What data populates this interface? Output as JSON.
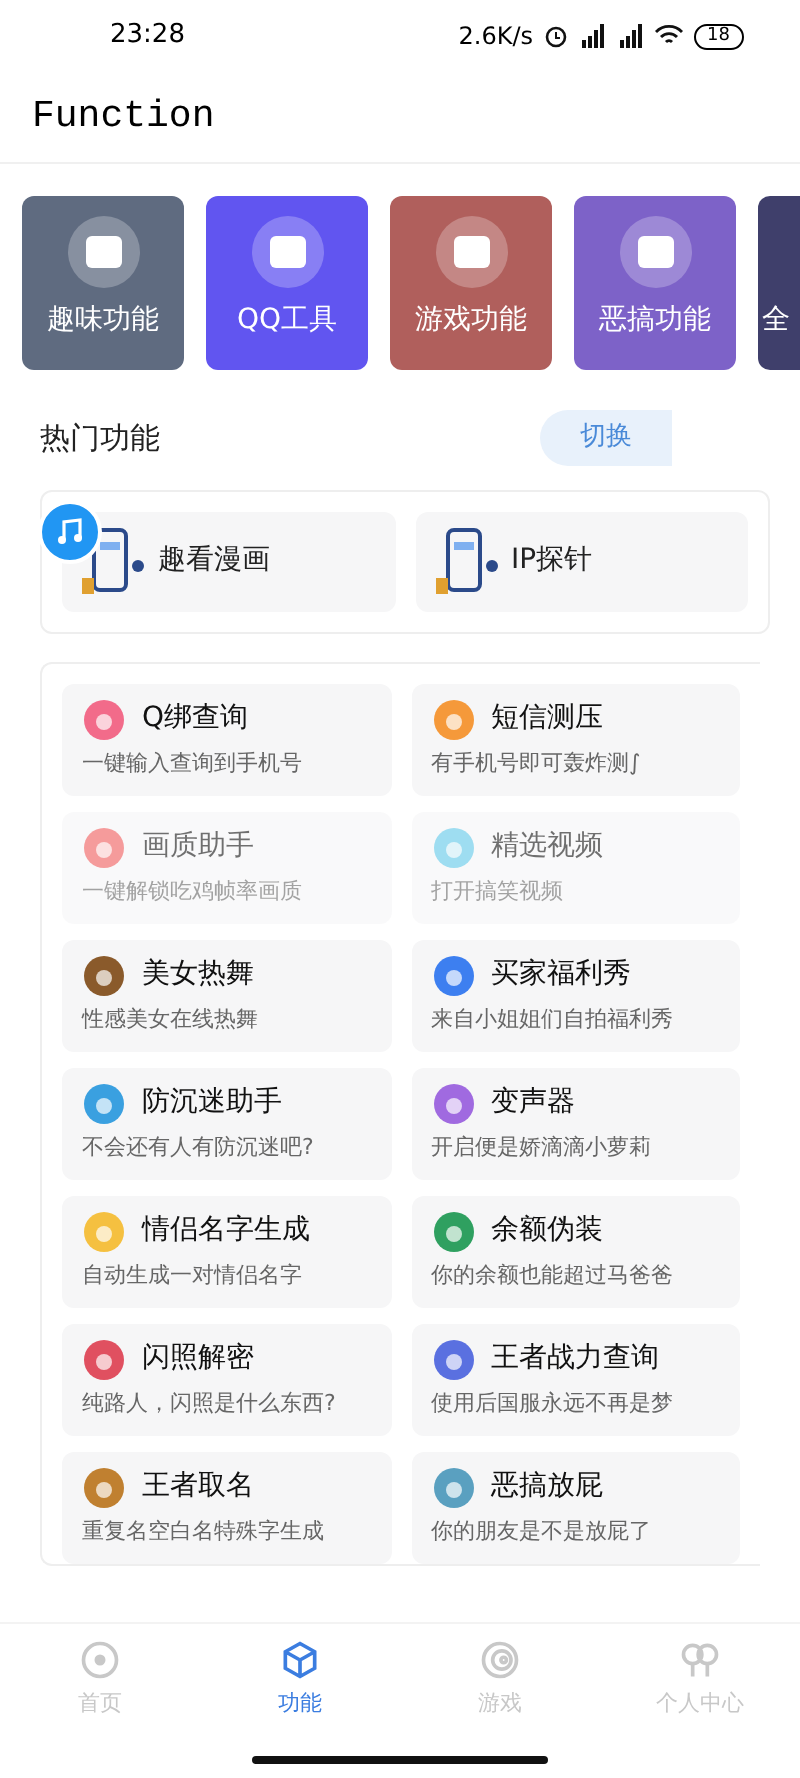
{
  "status_bar": {
    "time": "23:28",
    "speed": "2.6K/s",
    "battery": "18"
  },
  "header": {
    "title": "Function"
  },
  "categories": [
    {
      "label": "趣味功能",
      "color": "#5f6b80"
    },
    {
      "label": "QQ工具",
      "color": "#6155f0"
    },
    {
      "label": "游戏功能",
      "color": "#b05f5c"
    },
    {
      "label": "恶搞功能",
      "color": "#7d62c8"
    },
    {
      "label": "全",
      "color": "#3f3f6b"
    }
  ],
  "hot": {
    "title": "热门功能",
    "switch_label": "切换",
    "items": [
      {
        "label": "趣看漫画"
      },
      {
        "label": "IP探针"
      }
    ]
  },
  "functions": [
    {
      "title": "Q绑查询",
      "subtitle": "一键输入查询到手机号",
      "dimmed": false
    },
    {
      "title": "短信测压",
      "subtitle": "有手机号即可轰炸测∫",
      "dimmed": false
    },
    {
      "title": "画质助手",
      "subtitle": "一键解锁吃鸡帧率画质",
      "dimmed": true
    },
    {
      "title": "精选视频",
      "subtitle": "打开搞笑视频",
      "dimmed": true
    },
    {
      "title": "美女热舞",
      "subtitle": "性感美女在线热舞",
      "dimmed": false
    },
    {
      "title": "买家福利秀",
      "subtitle": "来自小姐姐们自拍福利秀",
      "dimmed": false
    },
    {
      "title": "防沉迷助手",
      "subtitle": "不会还有人有防沉迷吧?",
      "dimmed": false
    },
    {
      "title": "变声器",
      "subtitle": "开启便是娇滴滴小萝莉",
      "dimmed": false
    },
    {
      "title": "情侣名字生成",
      "subtitle": "自动生成一对情侣名字",
      "dimmed": false
    },
    {
      "title": "余额伪装",
      "subtitle": "你的余额也能超过马爸爸",
      "dimmed": false
    },
    {
      "title": "闪照解密",
      "subtitle": "纯路人，闪照是什么东西?",
      "dimmed": false
    },
    {
      "title": "王者战力查询",
      "subtitle": "使用后国服永远不再是梦",
      "dimmed": false
    },
    {
      "title": "王者取名",
      "subtitle": "重复名空白名特殊字生成",
      "dimmed": false
    },
    {
      "title": "恶搞放屁",
      "subtitle": "你的朋友是不是放屁了",
      "dimmed": false
    }
  ],
  "nav": [
    {
      "label": "首页",
      "selected": false
    },
    {
      "label": "功能",
      "selected": true
    },
    {
      "label": "游戏",
      "selected": false
    },
    {
      "label": "个人中心",
      "selected": false
    }
  ]
}
